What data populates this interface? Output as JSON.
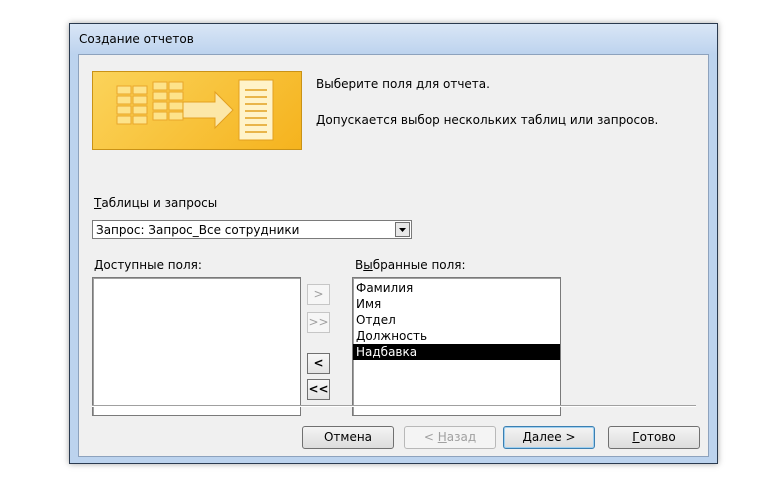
{
  "window": {
    "title": "Создание отчетов"
  },
  "intro": {
    "line1": "Выберите поля для отчета.",
    "line2": "Допускается выбор нескольких таблиц или запросов."
  },
  "tables": {
    "label_u": "Т",
    "label_rest": "аблицы и запросы",
    "selected": "Запрос: Запрос_Все сотрудники"
  },
  "available": {
    "label_u": "Д",
    "label_rest": "оступные поля:",
    "items": []
  },
  "selected_fields": {
    "label_pre": "В",
    "label_u": "ы",
    "label_rest": "бранные поля:",
    "items": [
      "Фамилия",
      "Имя",
      "Отдел",
      "Должность",
      "Надбавка"
    ],
    "selected_item": "Надбавка"
  },
  "move_buttons": {
    "add_one": ">",
    "add_all": ">>",
    "remove_one": "<",
    "remove_all": "<<"
  },
  "footer": {
    "cancel": "Отмена",
    "back_pre": "< ",
    "back_u": "Н",
    "back_rest": "азад",
    "next_u": "Д",
    "next_rest": "алее >",
    "finish_u": "Г",
    "finish_rest": "отово"
  },
  "colors": {
    "selection_bg": "#000000",
    "selection_fg": "#ffffff",
    "image_accent": "#f5b31e"
  }
}
